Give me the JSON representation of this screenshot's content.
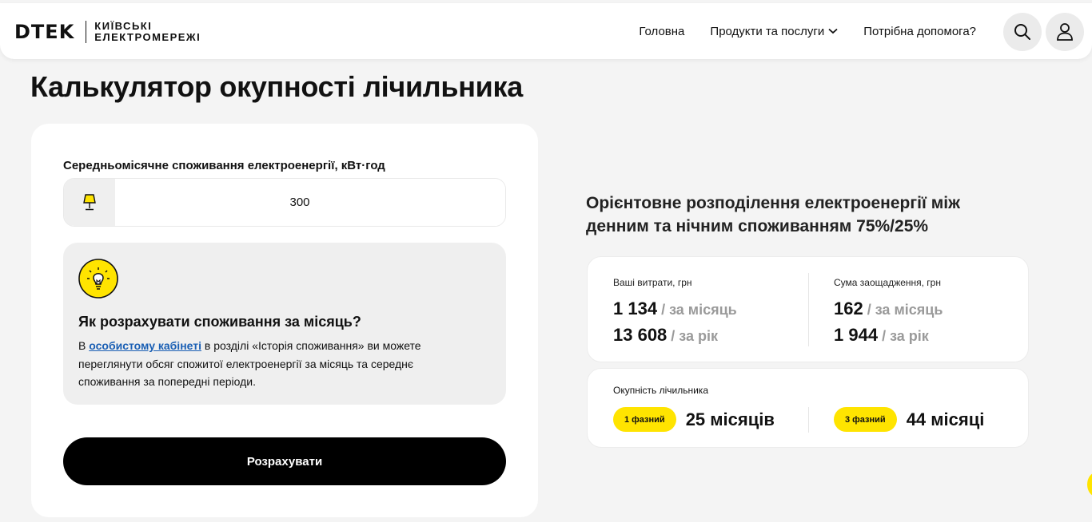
{
  "header": {
    "brand": "DTEK",
    "sub_line1": "КИЇВСЬКІ",
    "sub_line2": "ЕЛЕКТРОМЕРЕЖІ",
    "nav": [
      {
        "label": "Головна"
      },
      {
        "label": "Продукти та послуги"
      },
      {
        "label": "Потрібна допомога?"
      }
    ]
  },
  "page": {
    "title": "Калькулятор окупності лічильника"
  },
  "form": {
    "consumption_label": "Середньомісячне споживання електроенергії, кВт·год",
    "consumption_value": "300",
    "info_title": "Як розрахувати споживання за місяць?",
    "info_text_before": "В ",
    "info_link": "особистому кабінеті",
    "info_text_after": " в розділі «Історія споживання» ви можете переглянути обсяг спожитої електроенергії за місяць та середнє споживання за попередні періоди.",
    "calc_button": "Розрахувати"
  },
  "results": {
    "heading": "Орієнтовне розподілення електроенергії між денним та нічним споживанням 75%/25%",
    "costs": {
      "label": "Ваші витрати, грн",
      "monthly": "1 134",
      "monthly_unit": " / за місяць",
      "yearly": "13 608",
      "yearly_unit": " / за рік"
    },
    "savings": {
      "label": "Сума заощадження, грн",
      "monthly": "162",
      "monthly_unit": " / за місяць",
      "yearly": "1 944",
      "yearly_unit": " / за рік"
    },
    "payback": {
      "label": "Окупність лічильника",
      "single_phase_badge": "1 фазний",
      "single_phase_value": "25 місяців",
      "three_phase_badge": "3 фазний",
      "three_phase_value": "44 місяці"
    }
  },
  "colors": {
    "accent": "#ffe400",
    "link": "#1a5fb4",
    "button": "#000000"
  }
}
